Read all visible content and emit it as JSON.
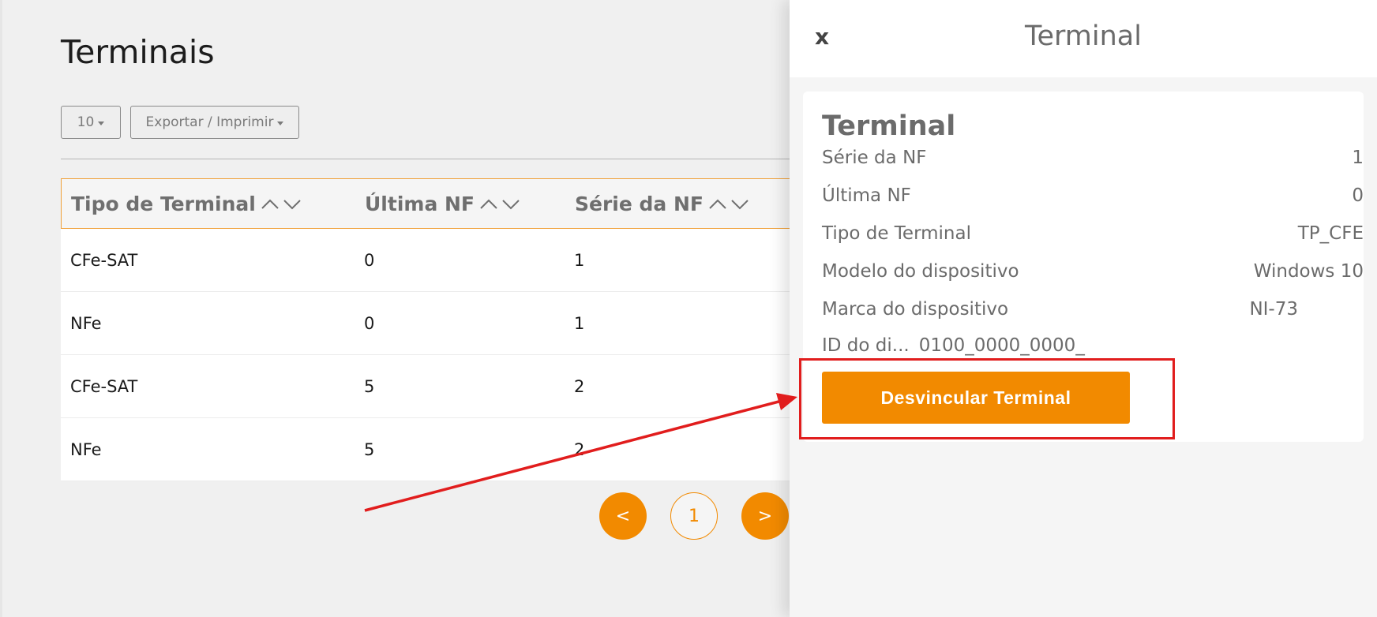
{
  "page": {
    "title": "Terminais",
    "page_size_value": "10",
    "export_label": "Exportar / Imprimir"
  },
  "table": {
    "columns": [
      "Tipo de Terminal",
      "Última NF",
      "Série da NF"
    ],
    "rows": [
      {
        "tipo": "CFe-SAT",
        "ultima_nf": "0",
        "serie": "1"
      },
      {
        "tipo": "NFe",
        "ultima_nf": "0",
        "serie": "1"
      },
      {
        "tipo": "CFe-SAT",
        "ultima_nf": "5",
        "serie": "2"
      },
      {
        "tipo": "NFe",
        "ultima_nf": "5",
        "serie": "2"
      }
    ]
  },
  "pagination": {
    "prev": "<",
    "current": "1",
    "next": ">"
  },
  "drawer": {
    "close": "x",
    "header_title": "Terminal",
    "card_title": "Terminal",
    "fields": [
      {
        "label": "Série da NF",
        "value": "1"
      },
      {
        "label": "Última NF",
        "value": "0"
      },
      {
        "label": "Tipo de Terminal",
        "value": "TP_CFE"
      },
      {
        "label": "Modelo do dispositivo",
        "value": "Windows 10"
      },
      {
        "label": "Marca do dispositivo",
        "value": "NI-73"
      }
    ],
    "id_label": "ID do di...",
    "id_value": "0100_0000_0000_",
    "unlink_button": "Desvincular Terminal"
  },
  "colors": {
    "accent": "#f28a00",
    "annotation": "#e11d1d"
  }
}
